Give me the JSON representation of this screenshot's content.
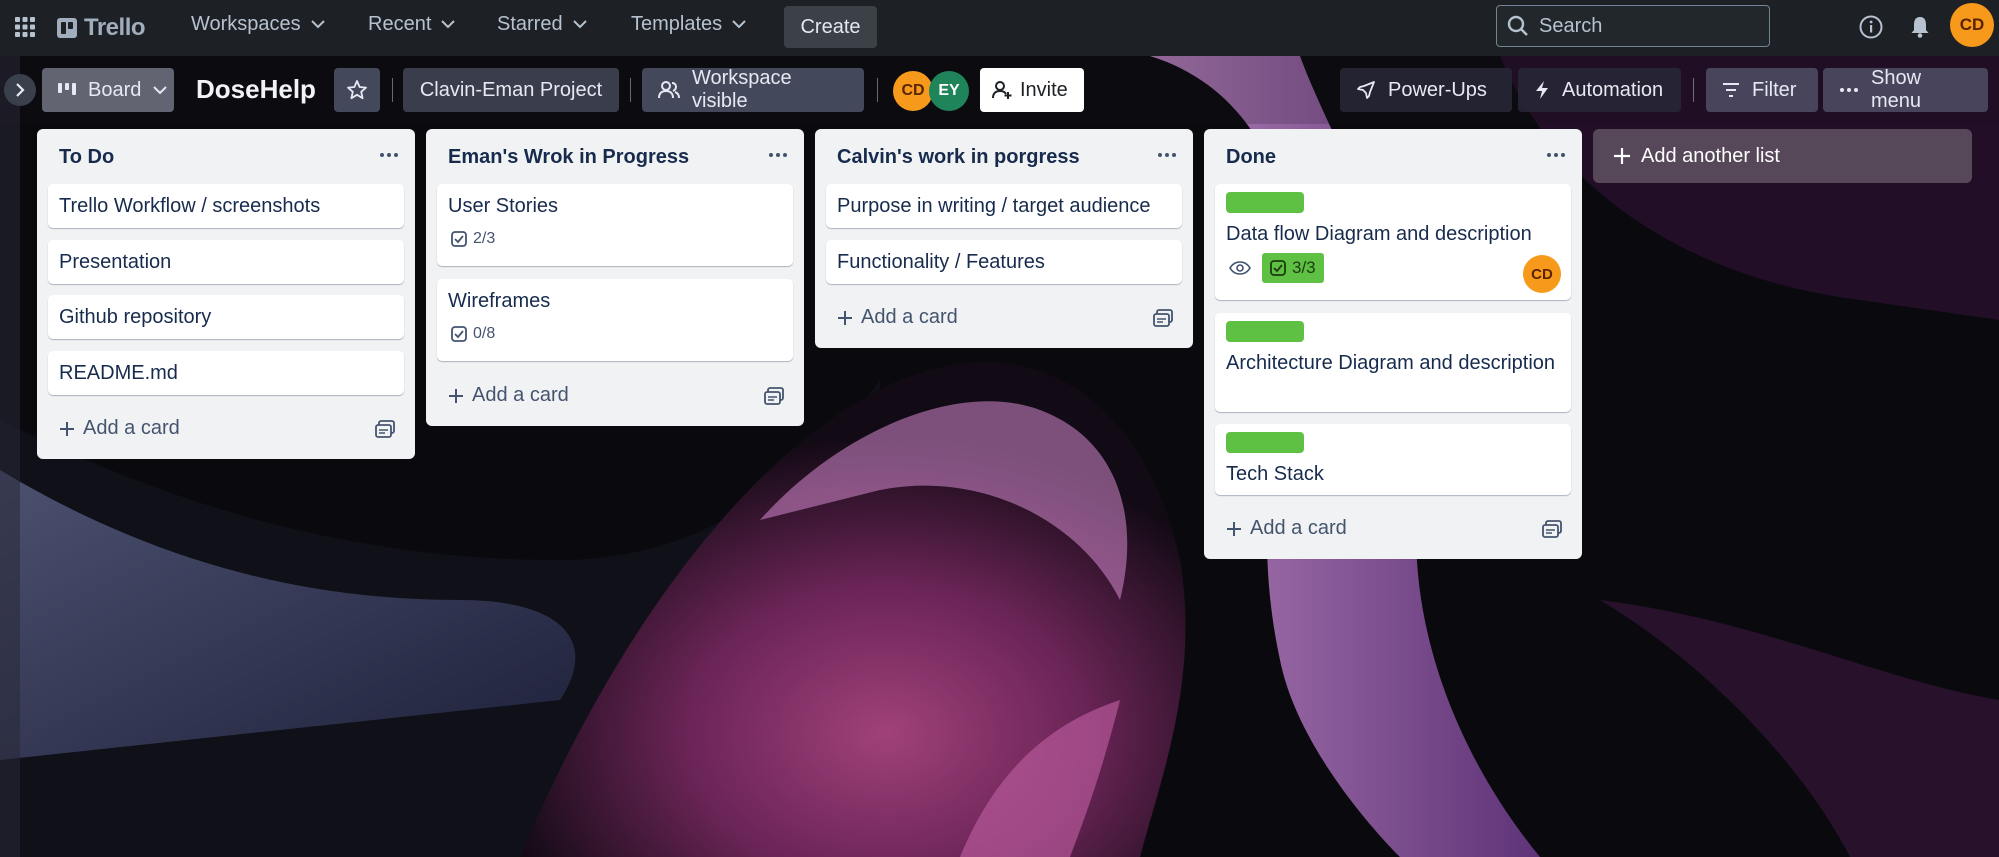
{
  "nav": {
    "logo": "Trello",
    "menus": [
      "Workspaces",
      "Recent",
      "Starred",
      "Templates"
    ],
    "create": "Create",
    "search_placeholder": "Search",
    "user_initials": "CD"
  },
  "board": {
    "view_label": "Board",
    "title": "DoseHelp",
    "project_label": "Clavin-Eman Project",
    "visibility_label": "Workspace visible",
    "members": [
      "CD",
      "EY"
    ],
    "invite": "Invite",
    "power_ups": "Power-Ups",
    "automation": "Automation",
    "filter": "Filter",
    "show_menu": "Show menu"
  },
  "lists": [
    {
      "title": "To Do",
      "cards": [
        {
          "title": "Trello Workflow / screenshots"
        },
        {
          "title": "Presentation"
        },
        {
          "title": "Github repository"
        },
        {
          "title": "README.md"
        }
      ],
      "add_card": "Add a card"
    },
    {
      "title": "Eman's Wrok in Progress",
      "cards": [
        {
          "title": "User Stories",
          "checklist": "2/3"
        },
        {
          "title": "Wireframes",
          "checklist": "0/8"
        }
      ],
      "add_card": "Add a card"
    },
    {
      "title": "Calvin's work in porgress",
      "cards": [
        {
          "title": "Purpose in writing / target audience"
        },
        {
          "title": "Functionality / Features"
        }
      ],
      "add_card": "Add a card"
    },
    {
      "title": "Done",
      "cards": [
        {
          "title": "Data flow Diagram and description",
          "label_color": "#5fc144",
          "checklist": "3/3",
          "member": "CD"
        },
        {
          "title": "Architecture Diagram and description",
          "label_color": "#5fc144"
        },
        {
          "title": "Tech Stack",
          "label_color": "#5fc144"
        }
      ],
      "add_card": "Add a card"
    }
  ],
  "add_list": "Add another list",
  "colors": {
    "nav_bg": "#1d2125",
    "list_bg": "#f1f2f4",
    "green_label": "#5fc144",
    "avatar_orange": "#f79a1c",
    "avatar_green": "#1f845a"
  }
}
